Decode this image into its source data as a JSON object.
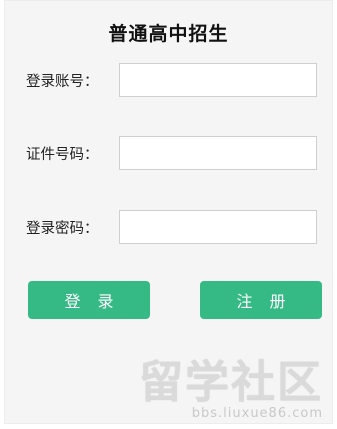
{
  "form": {
    "title": "普通高中招生",
    "account_label": "登录账号：",
    "account_value": "",
    "id_label": "证件号码：",
    "id_value": "",
    "password_label": "登录密码：",
    "password_value": "",
    "login_label": "登 录",
    "register_label": "注 册"
  },
  "watermark": {
    "logo_text": "留学社区",
    "url_text": "bbs.liuxue86.com"
  },
  "colors": {
    "accent": "#35b985",
    "panel_bg": "#f5f5f5"
  }
}
